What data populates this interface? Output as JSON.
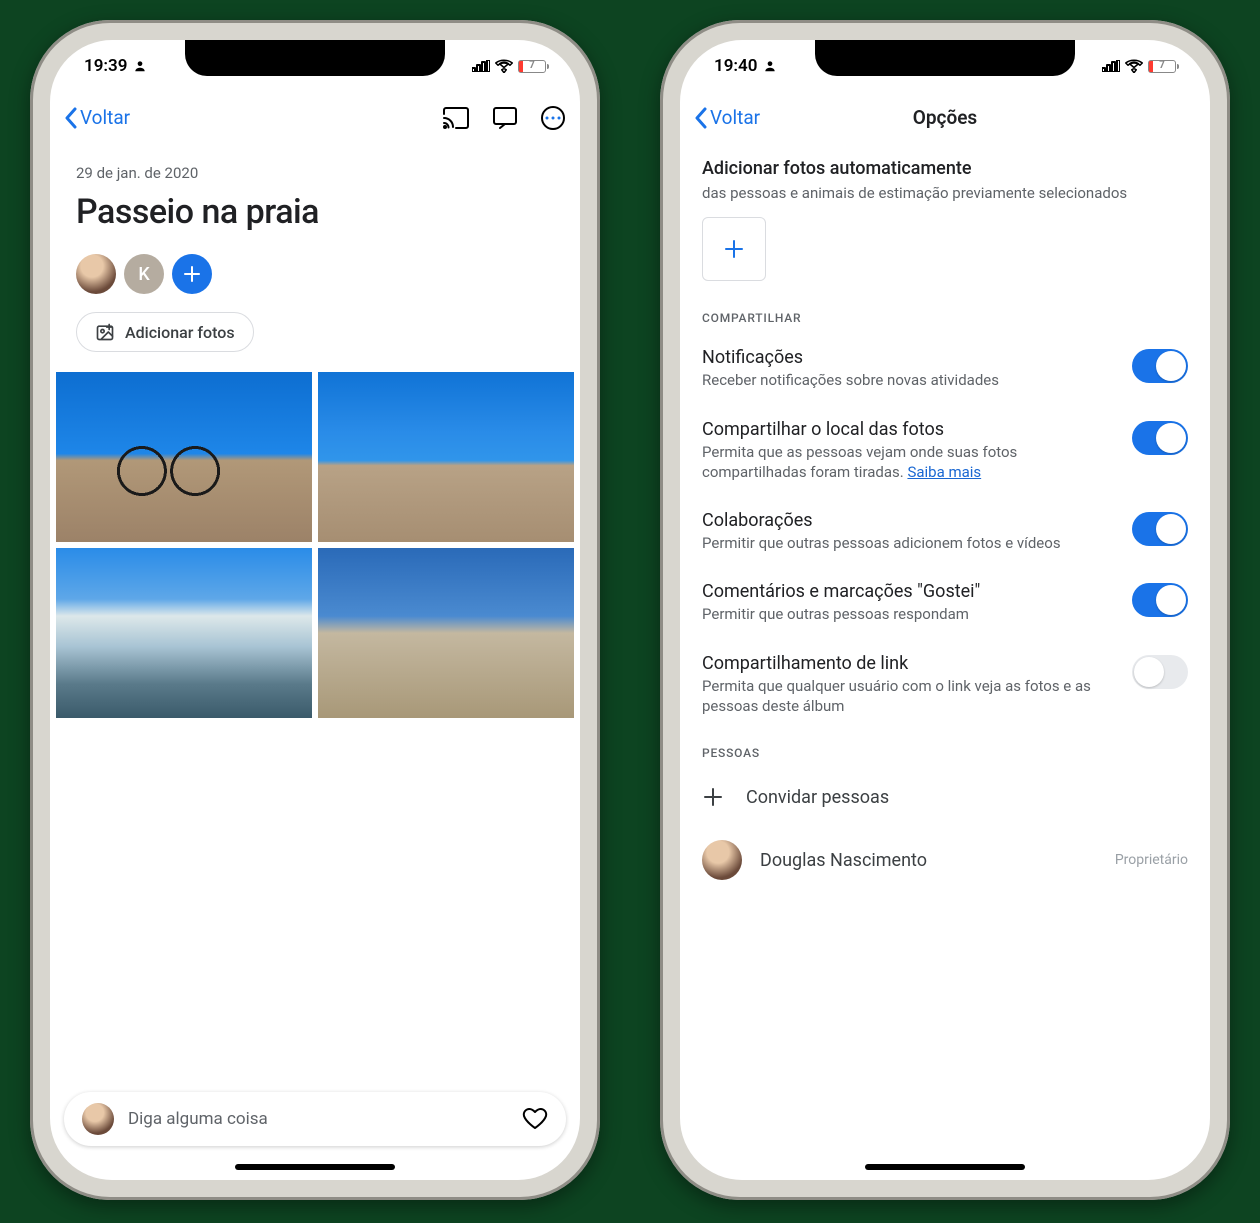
{
  "phone_left": {
    "status_time": "19:39",
    "battery": "7",
    "back": "Voltar",
    "date": "29 de jan. de 2020",
    "title": "Passeio na praia",
    "collab_initial": "K",
    "add_photos": "Adicionar fotos",
    "comment_placeholder": "Diga alguma coisa"
  },
  "phone_right": {
    "status_time": "19:40",
    "battery": "7",
    "back": "Voltar",
    "nav_title": "Opções",
    "auto_add": {
      "title": "Adicionar fotos automaticamente",
      "sub": "das pessoas e animais de estimação previamente selecionados"
    },
    "section_share": "COMPARTILHAR",
    "rows": [
      {
        "title": "Notificações",
        "sub": "Receber notificações sobre novas atividades",
        "on": true
      },
      {
        "title": "Compartilhar o local das fotos",
        "sub": "Permita que as pessoas vejam onde suas fotos compartilhadas foram tiradas. ",
        "link": "Saiba mais",
        "on": true
      },
      {
        "title": "Colaborações",
        "sub": "Permitir que outras pessoas adicionem fotos e vídeos",
        "on": true
      },
      {
        "title": "Comentários e marcações \"Gostei\"",
        "sub": "Permitir que outras pessoas respondam",
        "on": true
      },
      {
        "title": "Compartilhamento de link",
        "sub": "Permita que qualquer usuário com o link veja as fotos e as pessoas deste álbum",
        "on": false
      }
    ],
    "section_people": "PESSOAS",
    "invite": "Convidar pessoas",
    "person": {
      "name": "Douglas Nascimento",
      "role": "Proprietário"
    }
  }
}
